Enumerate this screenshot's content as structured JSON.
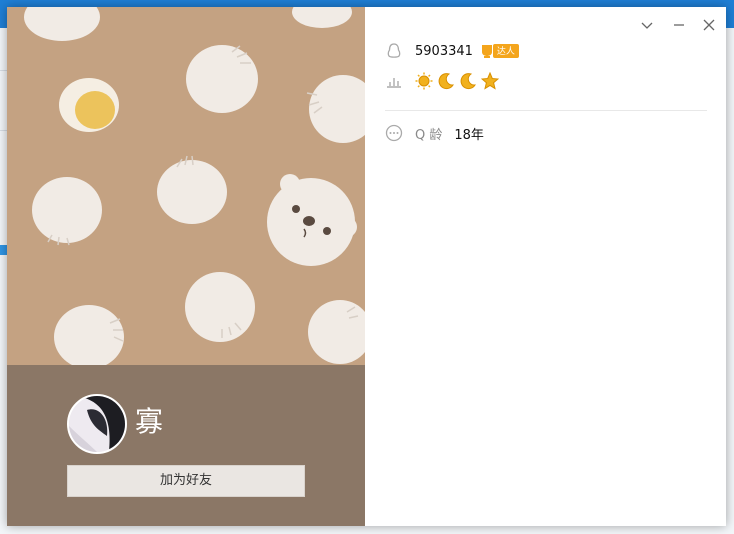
{
  "profile": {
    "nickname": "寡",
    "add_friend_label": "加为好友",
    "avatar_icon": "avatar-photo"
  },
  "info": {
    "qq_number": "5903341",
    "badge_label": "达人",
    "level_icons": [
      "sun-icon",
      "moon-icon",
      "moon-icon",
      "star-icon"
    ],
    "age_label": "Q 龄",
    "age_value": "18年"
  },
  "window_controls": [
    "chevron-down-icon",
    "minimize-icon",
    "close-icon"
  ],
  "colors": {
    "pattern_bg": "#c4a282",
    "profile_bg": "#8b7766",
    "bun": "#f1ebe5",
    "badge": "#f4a51c"
  }
}
